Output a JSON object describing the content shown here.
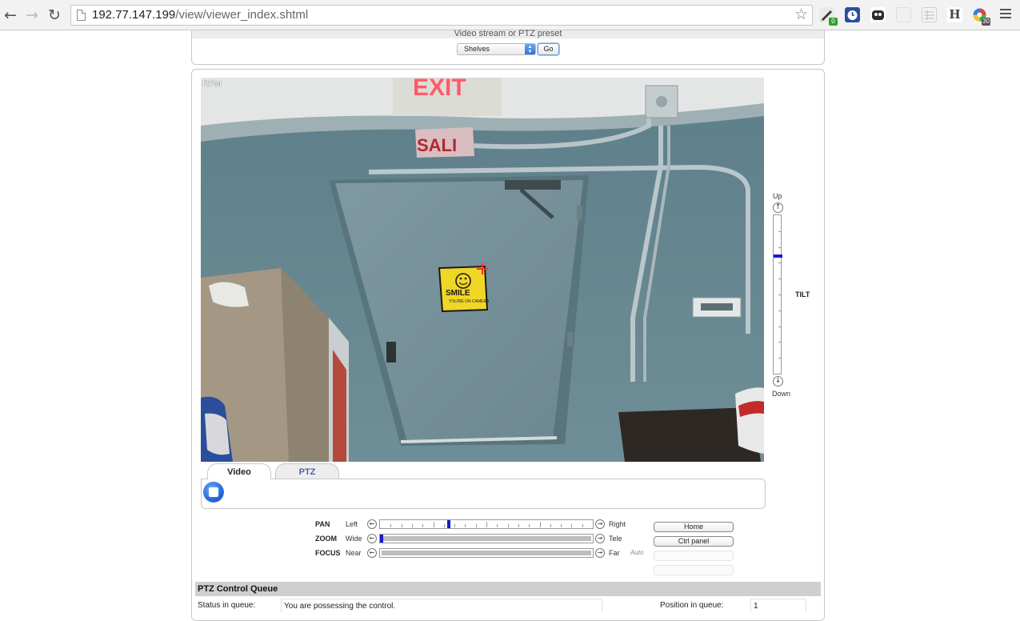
{
  "browser": {
    "url_host": "192.77.147.199",
    "url_path": "/view/viewer_index.shtml",
    "extensions": [
      {
        "icon": "pencil-extension-icon",
        "badge": "0",
        "color": "#3a3a3a",
        "badge_color": "#2fa12f"
      },
      {
        "icon": "clock-extension-icon",
        "color": "#2a4f9c"
      },
      {
        "icon": "ghostery-extension-icon",
        "color": "#2d2d2d"
      },
      {
        "icon": "blank-extension-icon",
        "color": "#e2e2e2"
      },
      {
        "icon": "table-extension-icon",
        "color": "#d8d8d8"
      },
      {
        "icon": "h-extension-icon",
        "label": "H",
        "color": "#ffffff"
      },
      {
        "icon": "color-wheel-extension-icon",
        "badge": "30",
        "color": "#d9363e",
        "badge_color": "#555555"
      }
    ]
  },
  "preset": {
    "title": "Video stream or PTZ preset",
    "selected": "Shelves",
    "go_label": "Go"
  },
  "camera": {
    "overlay_label": "RFM",
    "scene_texts": {
      "exit": "EXIT",
      "salida": "SALI",
      "sign_main": "SMILE",
      "sign_sub": "YOU'RE ON CAMERA"
    }
  },
  "tilt": {
    "up_label": "Up",
    "down_label": "Down",
    "name": "TILT",
    "position_fraction": 0.25
  },
  "tabs": [
    {
      "label": "Video",
      "active": true
    },
    {
      "label": "PTZ",
      "active": false
    }
  ],
  "ptz": {
    "pan": {
      "name": "PAN",
      "low": "Left",
      "high": "Right",
      "position_fraction": 0.32
    },
    "zoom": {
      "name": "ZOOM",
      "low": "Wide",
      "high": "Tele",
      "position_fraction": 0.0
    },
    "focus": {
      "name": "FOCUS",
      "low": "Near",
      "high": "Far",
      "auto": "Auto"
    }
  },
  "buttons": {
    "home": "Home",
    "ctrl_panel": "Ctrl panel"
  },
  "queue": {
    "title": "PTZ Control Queue",
    "status_label": "Status in queue:",
    "status_value": "You are possessing the control.",
    "position_label": "Position in queue:",
    "position_value": "1"
  }
}
